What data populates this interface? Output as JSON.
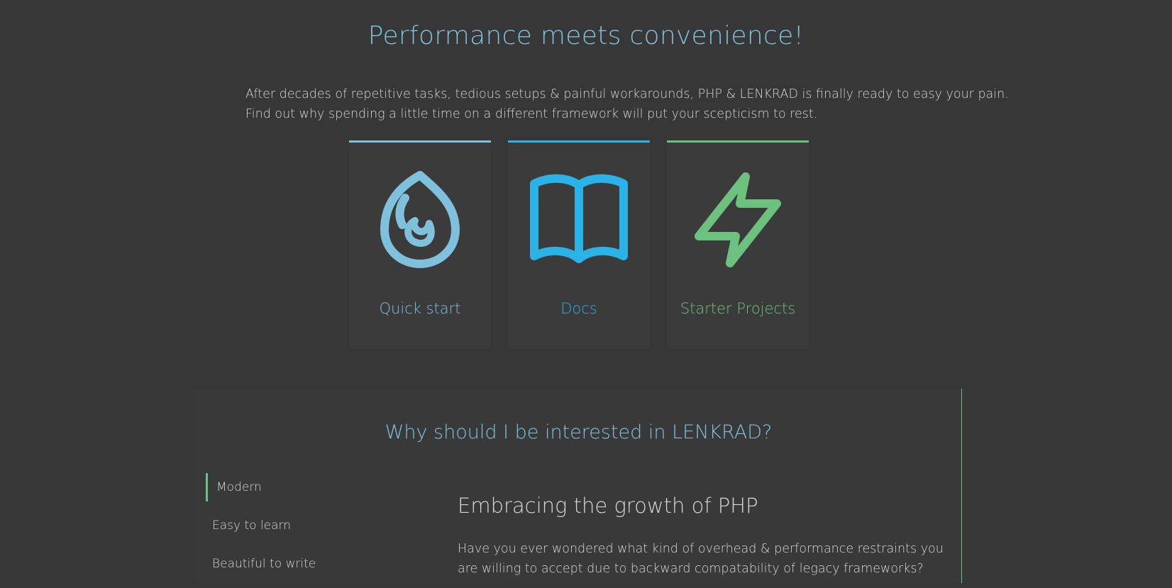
{
  "hero": {
    "title": "Performance meets convenience!",
    "intro_line1": "After decades of repetitive tasks, tedious setups & painful workarounds, PHP & LENKRAD is finally ready to easy your pain.",
    "intro_line2": "Find out why spending a little time on a different framework will put your scepticism to rest."
  },
  "cards": [
    {
      "label": "Quick start",
      "icon": "flame-icon",
      "color": "#7fc1dc"
    },
    {
      "label": "Docs",
      "icon": "book-icon",
      "color": "#2bb2e6"
    },
    {
      "label": "Starter Projects",
      "icon": "lightning-icon",
      "color": "#6cc17f"
    }
  ],
  "why": {
    "title": "Why should I be interested in LENKRAD?",
    "nav": [
      {
        "label": "Modern",
        "active": true
      },
      {
        "label": "Easy to learn",
        "active": false
      },
      {
        "label": "Beautiful to write",
        "active": false
      }
    ],
    "content": {
      "heading": "Embracing the growth of PHP",
      "paragraph": "Have you ever wondered what kind of overhead & performance restraints you are willing to accept due to backward compatability of legacy frameworks?"
    }
  },
  "colors": {
    "background": "#373737",
    "accent_light_blue": "#7fc1dc",
    "accent_blue": "#2bb2e6",
    "accent_green": "#6cc17f",
    "text": "#d6d6d6"
  }
}
